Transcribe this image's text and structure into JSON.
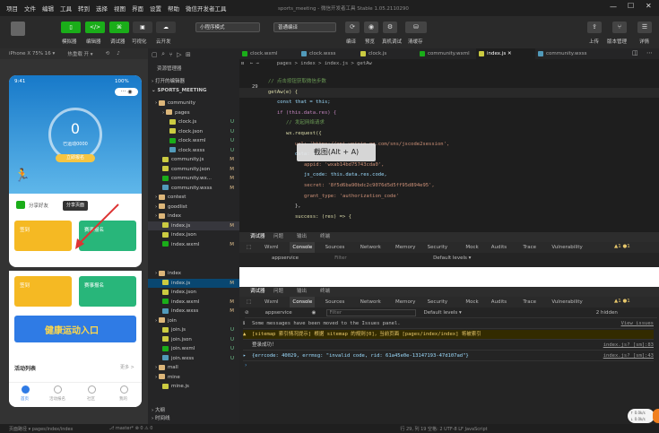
{
  "menubar": {
    "items": [
      "项目",
      "文件",
      "编辑",
      "工具",
      "转到",
      "选择",
      "视图",
      "界面",
      "设置",
      "帮助",
      "微信开发者工具"
    ],
    "title": "sports_meeting - 微信开发者工具 Stable 1.05.2110290"
  },
  "toolbar": {
    "left_buttons": [
      "模拟器",
      "编辑器",
      "调试器",
      "可视化",
      "云开发"
    ],
    "mode_select": "小程序模式",
    "compile_select": "普通编译",
    "center_labels": [
      "编译",
      "预览",
      "真机调试",
      "清缓存"
    ],
    "right_labels": [
      "上传",
      "版本管理",
      "详情"
    ]
  },
  "simbar": {
    "device": "iPhone X 75% 16 ▾",
    "network": "热重载 开 ▾"
  },
  "phone_top": {
    "time": "9:41",
    "battery": "100%",
    "big_number": "0",
    "sub": "已运动0000",
    "btn": "立即报名",
    "share_row": "分享好友",
    "mid_btn": "发布",
    "tooltip_btn": "分享页面",
    "card1": "签到",
    "card2": "赛事报名"
  },
  "phone_bottom": {
    "card1": "签到",
    "card2": "赛事报名",
    "banner": "健康运动入口",
    "section": "活动列表",
    "more": "更多 >",
    "nav": [
      "首页",
      "活动报名",
      "社区",
      "我的"
    ]
  },
  "tree_top": {
    "header": "资源管理器",
    "sec1": "打开的编辑器",
    "sec2": "SPORTS_MEETING",
    "items": [
      {
        "n": "community",
        "t": "",
        "c": "#dcb67a",
        "d": 1,
        "f": true
      },
      {
        "n": "pages",
        "t": "",
        "c": "#dcb67a",
        "d": 2,
        "f": true
      },
      {
        "n": "clock.js",
        "t": "U",
        "c": "#cbcb41",
        "d": 3
      },
      {
        "n": "clock.json",
        "t": "U",
        "c": "#cbcb41",
        "d": 3
      },
      {
        "n": "clock.wxml",
        "t": "U",
        "c": "#1aad19",
        "d": 3
      },
      {
        "n": "clock.wxss",
        "t": "U",
        "c": "#519aba",
        "d": 3
      },
      {
        "n": "community.js",
        "t": "M",
        "c": "#cbcb41",
        "d": 2
      },
      {
        "n": "community.json",
        "t": "M",
        "c": "#cbcb41",
        "d": 2
      },
      {
        "n": "community.wx...",
        "t": "M",
        "c": "#1aad19",
        "d": 2
      },
      {
        "n": "community.wxss",
        "t": "M",
        "c": "#519aba",
        "d": 2
      },
      {
        "n": "contest",
        "t": "",
        "c": "#dcb67a",
        "d": 1,
        "f": true
      },
      {
        "n": "goodlist",
        "t": "",
        "c": "#dcb67a",
        "d": 1,
        "f": true
      },
      {
        "n": "index",
        "t": "",
        "c": "#dcb67a",
        "d": 1,
        "f": true
      },
      {
        "n": "index.js",
        "t": "M",
        "c": "#cbcb41",
        "d": 2
      },
      {
        "n": "index.json",
        "t": "",
        "c": "#cbcb41",
        "d": 2
      },
      {
        "n": "index.wxml",
        "t": "M",
        "c": "#1aad19",
        "d": 2
      }
    ]
  },
  "tree_bottom": {
    "items": [
      {
        "n": "index",
        "t": "",
        "c": "#dcb67a",
        "d": 1,
        "f": true
      },
      {
        "n": "index.js",
        "t": "M",
        "c": "#cbcb41",
        "d": 2
      },
      {
        "n": "index.json",
        "t": "",
        "c": "#cbcb41",
        "d": 2
      },
      {
        "n": "index.wxml",
        "t": "M",
        "c": "#1aad19",
        "d": 2
      },
      {
        "n": "index.wxss",
        "t": "M",
        "c": "#519aba",
        "d": 2
      },
      {
        "n": "join",
        "t": "",
        "c": "#dcb67a",
        "d": 1,
        "f": true
      },
      {
        "n": "join.js",
        "t": "U",
        "c": "#cbcb41",
        "d": 2
      },
      {
        "n": "join.json",
        "t": "U",
        "c": "#cbcb41",
        "d": 2
      },
      {
        "n": "join.wxml",
        "t": "U",
        "c": "#1aad19",
        "d": 2
      },
      {
        "n": "join.wxss",
        "t": "U",
        "c": "#519aba",
        "d": 2
      },
      {
        "n": "mall",
        "t": "",
        "c": "#dcb67a",
        "d": 1,
        "f": true
      },
      {
        "n": "mine",
        "t": "",
        "c": "#dcb67a",
        "d": 1,
        "f": true
      },
      {
        "n": "mine.js",
        "t": "",
        "c": "#cbcb41",
        "d": 2
      }
    ],
    "outline": "大纲",
    "timeline": "时间线"
  },
  "editor": {
    "tabs": [
      "clock.wxml",
      "clock.wxss",
      "clock.js",
      "community.wxml",
      "index.js",
      "community.wxss"
    ],
    "active_tab": "index.js",
    "breadcrumb": "pages > index > index.js > getAw",
    "line_no": "29",
    "lines": [
      {
        "t": "// 点击按钮获取微信步数",
        "c": "#6a9955",
        "i": 1
      },
      {
        "t": "getAw(e) {",
        "c": "#dcdcaa",
        "i": 1
      },
      {
        "t": "const that = this;",
        "c": "#9cdcfe",
        "i": 2
      },
      {
        "t": "if (this.data.res) {",
        "c": "#c586c0",
        "i": 2
      },
      {
        "t": "// 发起网络请求",
        "c": "#6a9955",
        "i": 3
      },
      {
        "t": "wx.request({",
        "c": "#dcdcaa",
        "i": 3
      },
      {
        "t": "url: 'https://api.weixin.qq.com/sns/jscode2session',",
        "c": "#ce9178",
        "i": 4
      },
      {
        "t": "data: {",
        "c": "#9cdcfe",
        "i": 4
      },
      {
        "t": "appid: 'wxab14bd75743cda0',",
        "c": "#ce9178",
        "i": 5
      },
      {
        "t": "js_code: this.data.res.code,",
        "c": "#9cdcfe",
        "i": 5
      },
      {
        "t": "secret: '8f5d6ba90bdc2c9076d5d5ff95d894e95',",
        "c": "#ce9178",
        "i": 5
      },
      {
        "t": "grant_type: 'authorization_code'",
        "c": "#ce9178",
        "i": 5
      },
      {
        "t": "},",
        "c": "#d4d4d4",
        "i": 4
      },
      {
        "t": "success: (res) => {",
        "c": "#dcdcaa",
        "i": 4
      }
    ],
    "screenshot_tip": "截图(Alt + A)"
  },
  "devtools_top": {
    "tabs": [
      "调试器",
      "问题",
      "输出",
      "终端"
    ],
    "subtabs": [
      "Wxml",
      "Console",
      "Sources",
      "Network",
      "Memory",
      "Security",
      "Mock",
      "Audits",
      "Trace",
      "Vulnerability"
    ],
    "filter_scope": "appservice",
    "filter": "Filter",
    "levels": "Default levels ▾",
    "badge": "▲1 ●1"
  },
  "devtools_bottom": {
    "tabs": [
      "调试器",
      "问题",
      "输出",
      "终端"
    ],
    "subtabs": [
      "Wxml",
      "Console",
      "Sources",
      "Network",
      "Memory",
      "Security",
      "Mock",
      "Audits",
      "Trace",
      "Vulnerability"
    ],
    "filter_scope": "appservice",
    "filter": "Filter",
    "levels": "Default levels ▾",
    "hidden": "2 hidden",
    "badge": "▲1 ●1",
    "logs": [
      {
        "icon": "ℹ",
        "t": "Some messages have been moved to the Issues panel.",
        "src": "View issues",
        "c": "#bbb",
        "bg": "#242424"
      },
      {
        "icon": "▲",
        "t": "[sitemap 索引情况提示] 根据 sitemap 的规则[0]，当前页面 [pages/index/index] 将被索引",
        "src": "",
        "c": "#e8c86b",
        "bg": "#332b00"
      },
      {
        "icon": "",
        "t": "登录成功！",
        "src": "index.js? [sm]:83",
        "c": "#ccc",
        "bg": "#242424"
      },
      {
        "icon": "▸",
        "t": "{errcode: 40029, errmsg: \"invalid code, rid: 61a45e0e-13147193-47d107ad\"}",
        "src": "index.js? [sm]:43",
        "c": "#9cdcfe",
        "bg": "#242424"
      }
    ]
  },
  "statusbar": {
    "path": "页面路径 ▾  pages/index/index",
    "branch": "⎇ master*  ⊗ 0 ⚠ 0",
    "right": "行 29, 列 19   空格: 2   UTF-8   LF   JavaScript"
  },
  "float_widget": {
    "up": "↑ 0.0k/s",
    "down": "↓ 0.0k/s"
  },
  "colors": {
    "accent": "#1aad19",
    "phone_top": "#1f8fd6",
    "card_yellow": "#f5b923",
    "card_green": "#28b67a",
    "banner": "#2f7be5"
  }
}
